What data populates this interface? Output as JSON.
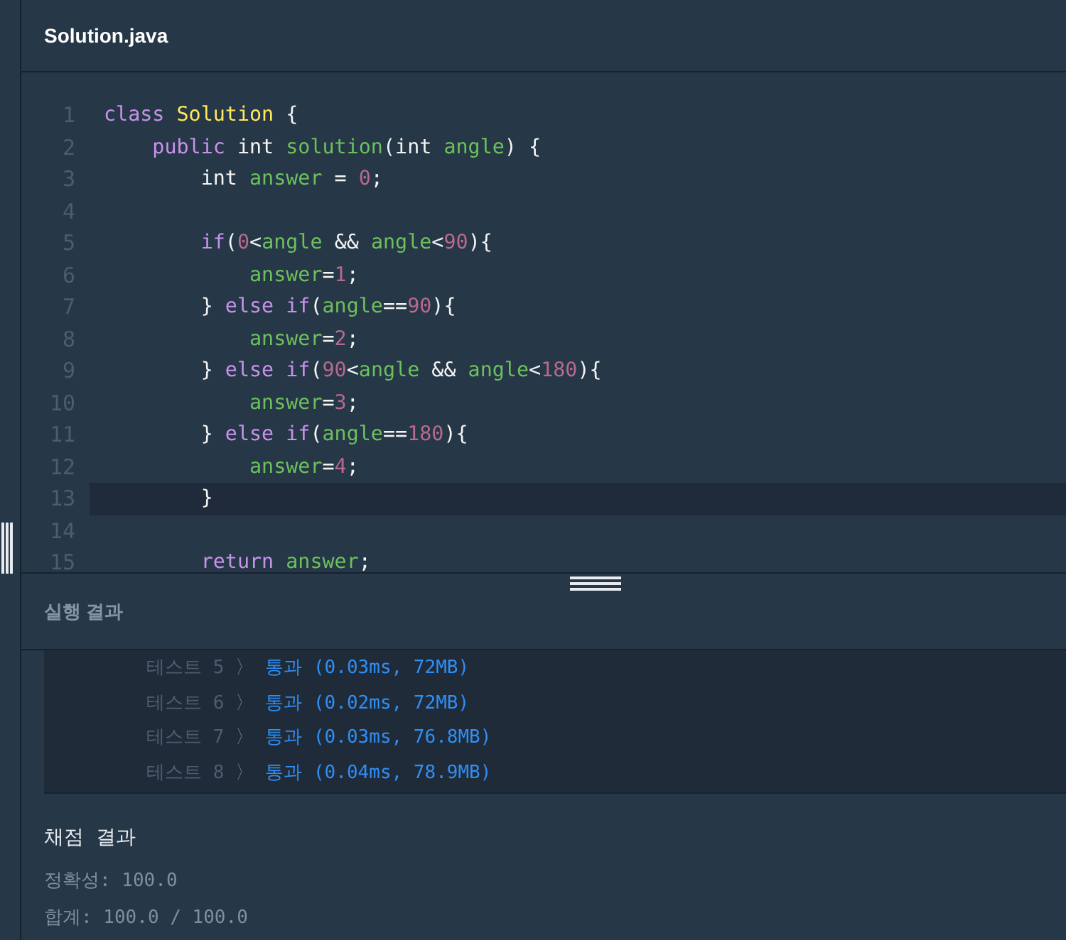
{
  "editor": {
    "filename": "Solution.java",
    "lines": [
      {
        "number": "1",
        "highlighted": false,
        "tokens": [
          {
            "kind": "keyword",
            "text": "class"
          },
          {
            "kind": "class",
            "text": " Solution"
          },
          {
            "kind": "plain",
            "text": " {"
          }
        ]
      },
      {
        "number": "2",
        "highlighted": false,
        "tokens": [
          {
            "kind": "keyword",
            "text": "    public"
          },
          {
            "kind": "plain",
            "text": " int "
          },
          {
            "kind": "ident",
            "text": "solution"
          },
          {
            "kind": "plain",
            "text": "(int "
          },
          {
            "kind": "ident",
            "text": "angle"
          },
          {
            "kind": "plain",
            "text": ") {"
          }
        ]
      },
      {
        "number": "3",
        "highlighted": false,
        "tokens": [
          {
            "kind": "plain",
            "text": "        int "
          },
          {
            "kind": "ident",
            "text": "answer"
          },
          {
            "kind": "plain",
            "text": " = "
          },
          {
            "kind": "number",
            "text": "0"
          },
          {
            "kind": "plain",
            "text": ";"
          }
        ]
      },
      {
        "number": "4",
        "highlighted": false
      },
      {
        "number": "5",
        "highlighted": false,
        "tokens": [
          {
            "kind": "keyword",
            "text": "        if"
          },
          {
            "kind": "plain",
            "text": "("
          },
          {
            "kind": "number",
            "text": "0"
          },
          {
            "kind": "plain",
            "text": "<"
          },
          {
            "kind": "ident",
            "text": "angle"
          },
          {
            "kind": "plain",
            "text": " && "
          },
          {
            "kind": "ident",
            "text": "angle"
          },
          {
            "kind": "plain",
            "text": "<"
          },
          {
            "kind": "number",
            "text": "90"
          },
          {
            "kind": "plain",
            "text": "){"
          }
        ]
      },
      {
        "number": "6",
        "highlighted": false,
        "tokens": [
          {
            "kind": "ident",
            "text": "            answer"
          },
          {
            "kind": "plain",
            "text": "="
          },
          {
            "kind": "number",
            "text": "1"
          },
          {
            "kind": "plain",
            "text": ";"
          }
        ]
      },
      {
        "number": "7",
        "highlighted": false,
        "tokens": [
          {
            "kind": "plain",
            "text": "        } "
          },
          {
            "kind": "keyword",
            "text": "else if"
          },
          {
            "kind": "plain",
            "text": "("
          },
          {
            "kind": "ident",
            "text": "angle"
          },
          {
            "kind": "plain",
            "text": "=="
          },
          {
            "kind": "number",
            "text": "90"
          },
          {
            "kind": "plain",
            "text": "){"
          }
        ]
      },
      {
        "number": "8",
        "highlighted": false,
        "tokens": [
          {
            "kind": "ident",
            "text": "            answer"
          },
          {
            "kind": "plain",
            "text": "="
          },
          {
            "kind": "number",
            "text": "2"
          },
          {
            "kind": "plain",
            "text": ";"
          }
        ]
      },
      {
        "number": "9",
        "highlighted": false,
        "tokens": [
          {
            "kind": "plain",
            "text": "        } "
          },
          {
            "kind": "keyword",
            "text": "else if"
          },
          {
            "kind": "plain",
            "text": "("
          },
          {
            "kind": "number",
            "text": "90"
          },
          {
            "kind": "plain",
            "text": "<"
          },
          {
            "kind": "ident",
            "text": "angle"
          },
          {
            "kind": "plain",
            "text": " && "
          },
          {
            "kind": "ident",
            "text": "angle"
          },
          {
            "kind": "plain",
            "text": "<"
          },
          {
            "kind": "number",
            "text": "180"
          },
          {
            "kind": "plain",
            "text": "){"
          }
        ]
      },
      {
        "number": "10",
        "highlighted": false,
        "tokens": [
          {
            "kind": "ident",
            "text": "            answer"
          },
          {
            "kind": "plain",
            "text": "="
          },
          {
            "kind": "number",
            "text": "3"
          },
          {
            "kind": "plain",
            "text": ";"
          }
        ]
      },
      {
        "number": "11",
        "highlighted": false,
        "tokens": [
          {
            "kind": "plain",
            "text": "        } "
          },
          {
            "kind": "keyword",
            "text": "else if"
          },
          {
            "kind": "plain",
            "text": "("
          },
          {
            "kind": "ident",
            "text": "angle"
          },
          {
            "kind": "plain",
            "text": "=="
          },
          {
            "kind": "number",
            "text": "180"
          },
          {
            "kind": "plain",
            "text": "){"
          }
        ]
      },
      {
        "number": "12",
        "highlighted": false,
        "tokens": [
          {
            "kind": "ident",
            "text": "            answer"
          },
          {
            "kind": "plain",
            "text": "="
          },
          {
            "kind": "number",
            "text": "4"
          },
          {
            "kind": "plain",
            "text": ";"
          }
        ]
      },
      {
        "number": "13",
        "highlighted": true,
        "tokens": [
          {
            "kind": "plain",
            "text": "        }"
          }
        ]
      },
      {
        "number": "14",
        "highlighted": false
      },
      {
        "number": "15",
        "highlighted": false,
        "tokens": [
          {
            "kind": "keyword",
            "text": "        return"
          },
          {
            "kind": "ident",
            "text": " answer"
          },
          {
            "kind": "plain",
            "text": ";"
          }
        ]
      }
    ]
  },
  "run_panel": {
    "title": "실행 결과",
    "tests": [
      {
        "label": "테스트 5",
        "separator": "〉",
        "result": "통과 (0.03ms, 72MB)"
      },
      {
        "label": "테스트 6",
        "separator": "〉",
        "result": "통과 (0.02ms, 72MB)"
      },
      {
        "label": "테스트 7",
        "separator": "〉",
        "result": "통과 (0.03ms, 76.8MB)"
      },
      {
        "label": "테스트 8",
        "separator": "〉",
        "result": "통과 (0.04ms, 78.9MB)"
      }
    ]
  },
  "grading": {
    "title": "채점 결과",
    "accuracy": "정확성: 100.0",
    "total": "합계: 100.0 / 100.0"
  }
}
